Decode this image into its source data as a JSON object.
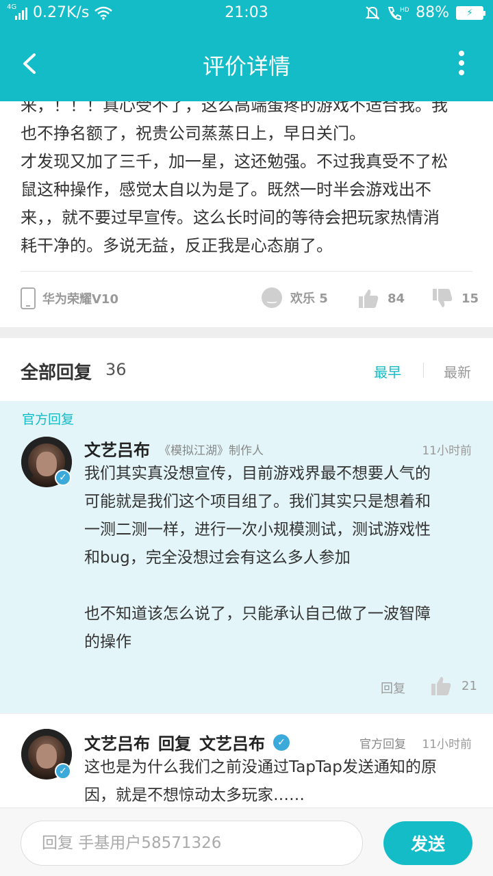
{
  "status_bar": {
    "network_label": "4G",
    "speed": "0.27K/s",
    "time": "21:03",
    "battery": "88%"
  },
  "app_bar": {
    "title": "评价详情"
  },
  "review": {
    "text": "来，！！！真心受不了，这么高端蛋疼的游戏不适合我。我\n也不挣名额了，祝贵公司蒸蒸日上，早日关门。\n才发现又加了三千，加一星，这还勉强。不过我真受不了松\n鼠这种操作，感觉太自以为是了。既然一时半会游戏出不\n来，，就不要过早宣传。这么长时间的等待会把玩家热情消\n耗干净的。多说无益，反正我是心态崩了。",
    "device": "华为荣耀V10",
    "mood": "欢乐 5",
    "likes": "84",
    "dislikes": "15"
  },
  "replies_header": {
    "title": "全部回复",
    "count": "36",
    "sort_earliest": "最早",
    "sort_latest": "最新"
  },
  "official_reply": {
    "tag": "官方回复",
    "author": "文艺吕布",
    "role": "《模拟江湖》制作人",
    "time": "11小时前",
    "body": "我们其实真没想宣传，目前游戏界最不想要人气的\n可能就是我们这个项目组了。我们其实只是想着和\n一测二测一样，进行一次小规模测试，测试游戏性\n和bug，完全没想过会有这么多人参加\n\n也不知道该怎么说了，只能承认自己做了一波智障\n的操作",
    "reply_label": "回复",
    "likes": "21"
  },
  "sub_reply": {
    "author": "文艺吕布",
    "reply_word": "回复",
    "target": "文艺吕布",
    "tag": "官方回复",
    "time": "11小时前",
    "body": "这也是为什么我们之前没通过TapTap发送通知的原\n因，就是不想惊动太多玩家……"
  },
  "bottom_bar": {
    "placeholder": "回复 手基用户58571326",
    "send_label": "发送"
  },
  "colors": {
    "accent": "#14bcc7",
    "official_bg": "#e3f5f8",
    "verify": "#3ba9d9"
  },
  "icons": [
    "signal-icon",
    "wifi-icon",
    "bell-mute-icon",
    "hd-call-icon",
    "battery-icon",
    "back-icon",
    "more-icon",
    "phone-icon",
    "smile-icon",
    "thumbs-up-icon",
    "thumbs-down-icon",
    "verified-icon"
  ]
}
